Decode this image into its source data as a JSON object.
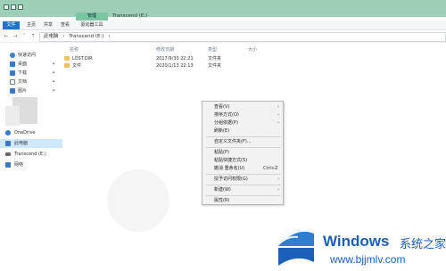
{
  "window": {
    "manage_tab": "管理",
    "title": "Transcend (E:)"
  },
  "ribbon": {
    "tabs": [
      "文件",
      "主页",
      "共享",
      "查看",
      "驱动器工具"
    ]
  },
  "address": {
    "crumbs": [
      "此电脑",
      "›",
      "Transcend (E:)",
      "›"
    ]
  },
  "sidebar": {
    "items": [
      {
        "label": "快速访问",
        "icon": "star-icon",
        "color": "#3b82d6"
      },
      {
        "label": "桌面",
        "icon": "desktop-icon",
        "color": "#3a78c8",
        "pinned": true
      },
      {
        "label": "下载",
        "icon": "download-icon",
        "color": "#3a78c8",
        "pinned": true
      },
      {
        "label": "文档",
        "icon": "document-icon",
        "color": "#6b7b8c",
        "pinned": true
      },
      {
        "label": "图片",
        "icon": "picture-icon",
        "color": "#3a78c8",
        "pinned": true
      },
      {
        "label": "OneDrive",
        "icon": "cloud-icon",
        "color": "#2f7dd1"
      },
      {
        "label": "此电脑",
        "icon": "pc-icon",
        "color": "#3a78c8",
        "selected": true
      },
      {
        "label": "Transcend (E:)",
        "icon": "drive-icon",
        "color": "#6b6b6b"
      },
      {
        "label": "网络",
        "icon": "network-icon",
        "color": "#3a78c8"
      }
    ]
  },
  "columns": [
    "名称",
    "修改日期",
    "类型",
    "大小"
  ],
  "files": [
    {
      "name": "LOST.DIR",
      "date": "2017/9/30 22:21",
      "type": "文件夹",
      "size": ""
    },
    {
      "name": "文件",
      "date": "2020/1/13 22:13",
      "type": "文件夹",
      "size": ""
    }
  ],
  "context_menu": {
    "items": [
      {
        "label": "查看(V)",
        "submenu": true
      },
      {
        "label": "排序方式(O)",
        "submenu": true
      },
      {
        "label": "分组依据(P)",
        "submenu": true
      },
      {
        "label": "刷新(E)"
      },
      {
        "sep": true
      },
      {
        "label": "自定义文件夹(F)..."
      },
      {
        "sep": true
      },
      {
        "label": "粘贴(P)"
      },
      {
        "label": "粘贴快捷方式(S)"
      },
      {
        "label": "撤消 重命名(U)",
        "shortcut": "Ctrl+Z"
      },
      {
        "sep": true
      },
      {
        "label": "授予访问权限(G)",
        "submenu": true
      },
      {
        "sep": true
      },
      {
        "label": "新建(W)",
        "submenu": true
      },
      {
        "sep": true
      },
      {
        "label": "属性(R)"
      }
    ]
  },
  "watermark": {
    "brand": "Windows",
    "cn": "系统之家",
    "url": "www.bjjmlv.com"
  }
}
